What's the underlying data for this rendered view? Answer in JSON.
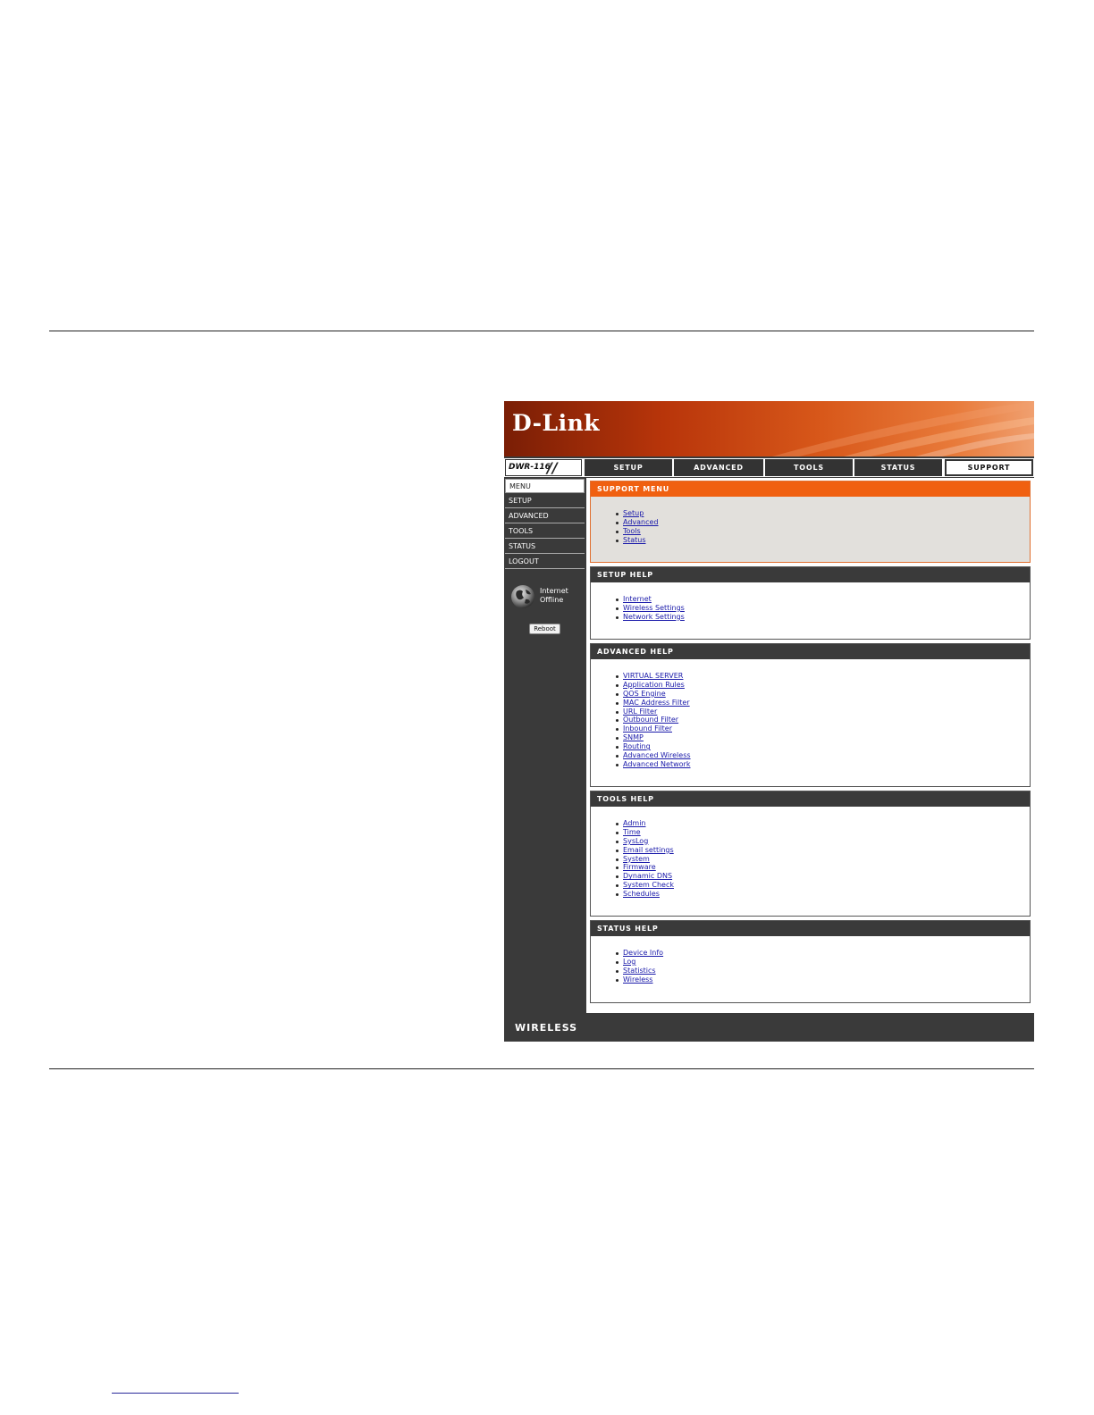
{
  "header": {
    "logo": "D-Link",
    "model": "DWR-116"
  },
  "nav": {
    "tabs": [
      {
        "label": "SETUP"
      },
      {
        "label": "ADVANCED"
      },
      {
        "label": "TOOLS"
      },
      {
        "label": "STATUS"
      },
      {
        "label": "SUPPORT",
        "active": true
      }
    ]
  },
  "sidebar": {
    "items": [
      {
        "label": "MENU"
      },
      {
        "label": "SETUP"
      },
      {
        "label": "ADVANCED"
      },
      {
        "label": "TOOLS"
      },
      {
        "label": "STATUS"
      },
      {
        "label": "LOGOUT"
      }
    ],
    "internet_line1": "Internet",
    "internet_line2": "Offline",
    "reboot_label": "Reboot"
  },
  "sections": {
    "support_menu": {
      "title": "SUPPORT MENU",
      "links": [
        "Setup",
        "Advanced",
        "Tools",
        "Status"
      ]
    },
    "setup_help": {
      "title": "SETUP HELP",
      "links": [
        "Internet",
        "Wireless Settings",
        "Network Settings"
      ]
    },
    "advanced_help": {
      "title": "ADVANCED HELP",
      "links": [
        "VIRTUAL SERVER",
        "Application Rules",
        "QOS Engine",
        "MAC Address Filter",
        "URL Filter",
        "Outbound Filter",
        "Inbound Filter",
        "SNMP",
        "Routing",
        "Advanced Wireless",
        "Advanced Network"
      ]
    },
    "tools_help": {
      "title": "TOOLS HELP",
      "links": [
        "Admin",
        "Time",
        "SysLog",
        "Email settings",
        "System",
        "Firmware",
        "Dynamic DNS",
        "System Check",
        "Schedules"
      ]
    },
    "status_help": {
      "title": "STATUS HELP",
      "links": [
        "Device Info",
        "Log",
        "Statistics",
        "Wireless"
      ]
    }
  },
  "footer": {
    "label": "WIRELESS"
  },
  "colors": {
    "accent_orange": "#f06010",
    "dark_gray": "#3a3a3a",
    "link_blue": "#1a1aaa"
  }
}
